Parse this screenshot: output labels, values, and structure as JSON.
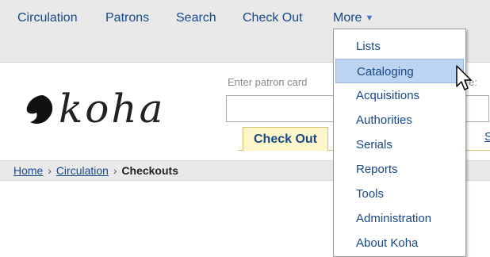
{
  "nav": {
    "items": [
      {
        "label": "Circulation"
      },
      {
        "label": "Patrons"
      },
      {
        "label": "Search"
      },
      {
        "label": "Check Out"
      }
    ],
    "more_label": "More",
    "more_icon": "caret-down-icon"
  },
  "logo": {
    "text": "koha",
    "icon": "koha-leaf-icon"
  },
  "patron": {
    "label": "Enter patron card",
    "label_right": "e:",
    "input_value": ""
  },
  "tabs": {
    "active_label": "Check Out",
    "next_label": "S"
  },
  "breadcrumb": {
    "home": "Home",
    "sep1": "›",
    "circulation": "Circulation",
    "sep2": "›",
    "current": "Checkouts"
  },
  "more_menu": {
    "items": [
      {
        "label": "Lists"
      },
      {
        "label": "Cataloging"
      },
      {
        "label": "Acquisitions"
      },
      {
        "label": "Authorities"
      },
      {
        "label": "Serials"
      },
      {
        "label": "Reports"
      },
      {
        "label": "Tools"
      },
      {
        "label": "Administration"
      },
      {
        "label": "About Koha"
      }
    ],
    "highlighted_index": 1
  },
  "colors": {
    "link": "#164889",
    "bar_bg": "#e9e9e9",
    "tab_bg": "#fff6c9",
    "menu_highlight": "#bcd3f2"
  }
}
